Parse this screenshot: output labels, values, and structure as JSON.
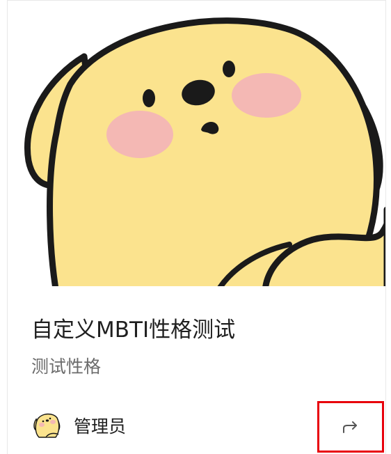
{
  "card": {
    "title": "自定义MBTI性格测试",
    "subtitle": "测试性格",
    "author": {
      "name": "管理员",
      "avatar": "yellow-puppy-avatar"
    },
    "cover_image": "yellow-puppy-illustration",
    "share_icon": "share-icon"
  },
  "colors": {
    "puppy_fill": "#fbe38e",
    "puppy_outline": "#1a1a1a",
    "blush": "#f4b8b4",
    "highlight_border": "#e8000b",
    "title_text": "#1f1f1f",
    "subtitle_text": "#6b6b6b"
  }
}
